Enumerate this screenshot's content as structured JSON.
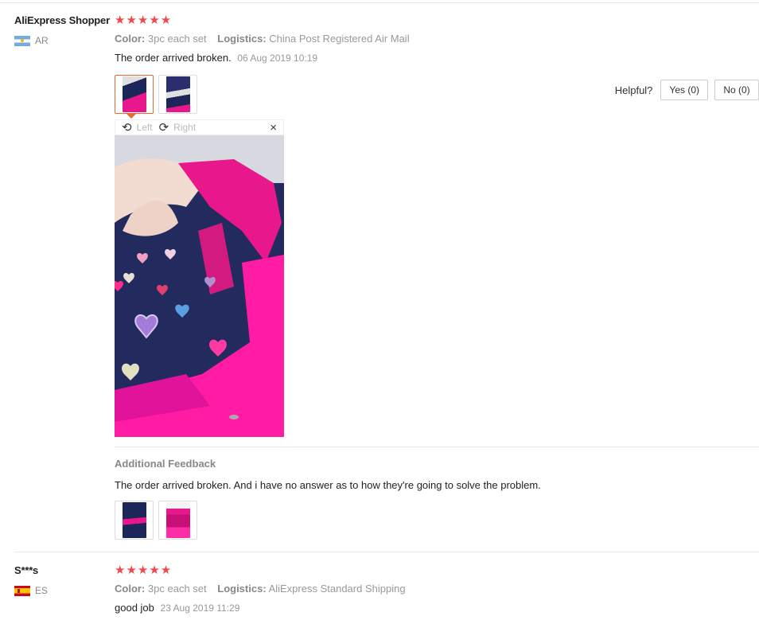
{
  "reviews": [
    {
      "user": "AliExpress Shopper",
      "country": "AR",
      "stars": "★★★★★",
      "color_label": "Color:",
      "color_value": "3pc each set",
      "logistics_label": "Logistics:",
      "logistics_value": "China Post Registered Air Mail",
      "feedback": "The order arrived broken.",
      "date": "06 Aug 2019 10:19",
      "helpful": {
        "label": "Helpful?",
        "yes": "Yes (0)",
        "no": "No (0)"
      },
      "viewer": {
        "left_label": "Left",
        "right_label": "Right",
        "close": "×",
        "rotate_left_icon": "⟲",
        "rotate_right_icon": "⟳"
      },
      "additional_title": "Additional Feedback",
      "additional_text": "The order arrived broken. And i have no answer as to how they're going to solve the problem."
    },
    {
      "user": "S***s",
      "country": "ES",
      "stars": "★★★★★",
      "color_label": "Color:",
      "color_value": "3pc each set",
      "logistics_label": "Logistics:",
      "logistics_value": "AliExpress Standard Shipping",
      "feedback": "good job",
      "date": "23 Aug 2019 11:29"
    }
  ],
  "colors": {
    "accent": "#e6692e",
    "star": "#f0494d",
    "pink": "#e8178c",
    "navy": "#1c2659"
  },
  "icons": {
    "flag_ar": "argentina-flag-icon",
    "flag_es": "spain-flag-icon",
    "rotate_left": "rotate-left-icon",
    "rotate_right": "rotate-right-icon",
    "close": "close-icon"
  }
}
